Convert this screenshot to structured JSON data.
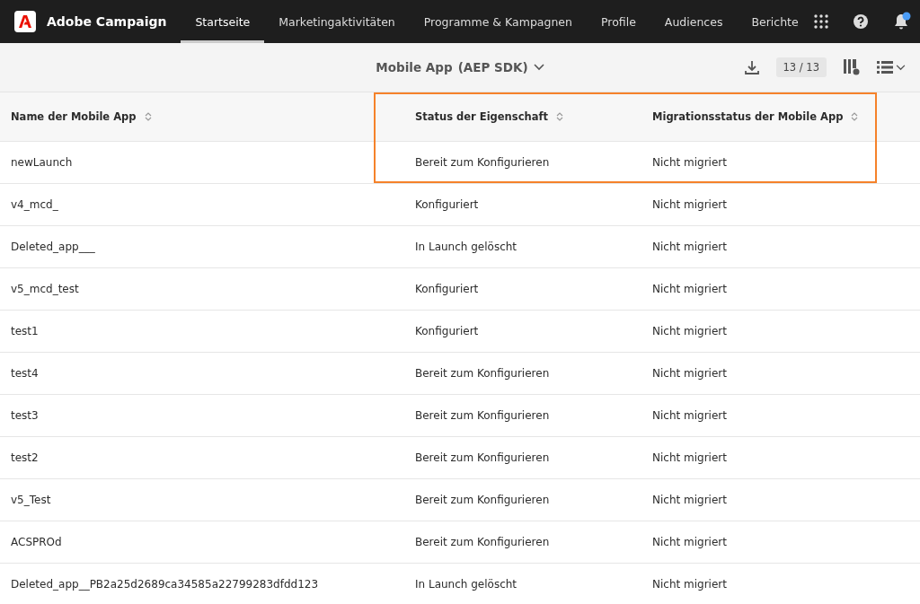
{
  "app": {
    "name": "Adobe Campaign"
  },
  "nav": [
    {
      "label": "Startseite",
      "selected": true
    },
    {
      "label": "Marketingaktivitäten",
      "selected": false
    },
    {
      "label": "Programme & Kampagnen",
      "selected": false
    },
    {
      "label": "Profile",
      "selected": false
    },
    {
      "label": "Audiences",
      "selected": false
    },
    {
      "label": "Berichte",
      "selected": false
    }
  ],
  "notifications": {
    "unread": true
  },
  "toolbar": {
    "title": "Mobile App",
    "subtitle": "(AEP SDK)",
    "count": "13 / 13"
  },
  "table": {
    "columns": [
      "Name der Mobile App",
      "Status der Eigenschaft",
      "Migrationsstatus der Mobile App"
    ],
    "rows": [
      [
        "newLaunch",
        "Bereit zum Konfigurieren",
        "Nicht migriert"
      ],
      [
        "v4_mcd_",
        "Konfiguriert",
        "Nicht migriert"
      ],
      [
        "Deleted_app___",
        "In Launch gelöscht",
        "Nicht migriert"
      ],
      [
        "v5_mcd_test",
        "Konfiguriert",
        "Nicht migriert"
      ],
      [
        "test1",
        "Konfiguriert",
        "Nicht migriert"
      ],
      [
        "test4",
        "Bereit zum Konfigurieren",
        "Nicht migriert"
      ],
      [
        "test3",
        "Bereit zum Konfigurieren",
        "Nicht migriert"
      ],
      [
        "test2",
        "Bereit zum Konfigurieren",
        "Nicht migriert"
      ],
      [
        "v5_Test",
        "Bereit zum Konfigurieren",
        "Nicht migriert"
      ],
      [
        "ACSPROd",
        "Bereit zum Konfigurieren",
        "Nicht migriert"
      ],
      [
        "Deleted_app__PB2a25d2689ca34585a22799283dfdd123",
        "In Launch gelöscht",
        "Nicht migriert"
      ]
    ]
  }
}
